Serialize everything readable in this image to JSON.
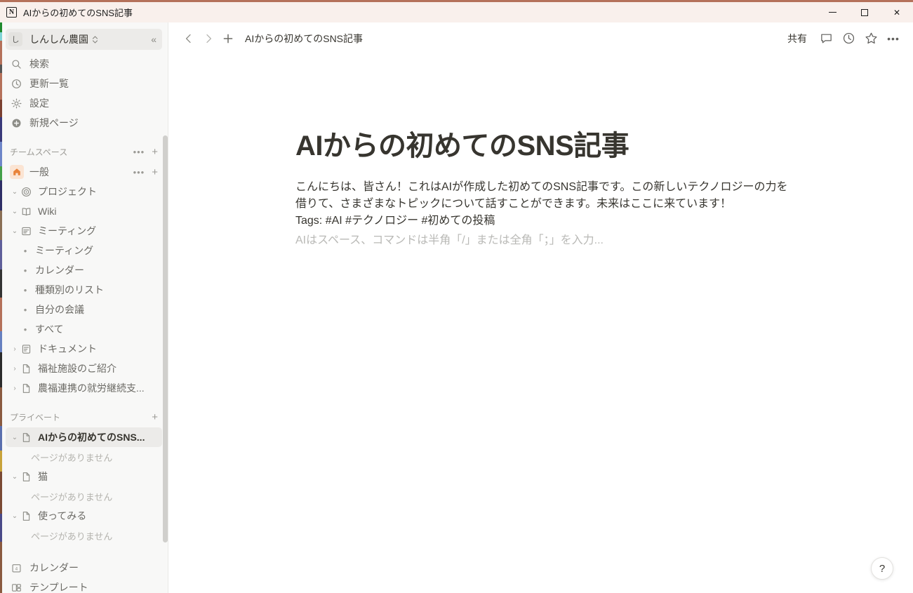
{
  "titlebar": {
    "logo_icon": "notion-logo-icon",
    "title": "AIからの初めてのSNS記事",
    "minimize_label": "",
    "maximize_label": "",
    "close_label": "✕"
  },
  "sidebar": {
    "workspace": {
      "avatar_text": "し",
      "name": "しんしん農園",
      "chevron_icon": "chevron-updown-icon",
      "collapse_icon": "collapse-sidebar-icon",
      "collapse_glyph": "«"
    },
    "nav": [
      {
        "label": "検索",
        "icon": "search-icon"
      },
      {
        "label": "更新一覧",
        "icon": "clock-icon"
      },
      {
        "label": "設定",
        "icon": "gear-icon"
      },
      {
        "label": "新規ページ",
        "icon": "plus-circle-icon"
      }
    ],
    "teamspace_section": {
      "title": "チームスペース",
      "dots": "•••",
      "plus": "+"
    },
    "teamspace_items": [
      {
        "label": "一般",
        "icon": "home-icon",
        "type": "home",
        "has_actions": true,
        "dots": "•••",
        "plus": "+"
      },
      {
        "label": "プロジェクト",
        "icon": "target-icon",
        "type": "page",
        "toggle": "⌄"
      },
      {
        "label": "Wiki",
        "icon": "book-icon",
        "type": "page",
        "toggle": "⌄"
      },
      {
        "label": "ミーティング",
        "icon": "list-icon",
        "type": "page",
        "toggle": "⌄"
      }
    ],
    "meeting_children": [
      {
        "label": "ミーティング",
        "bullet": "•"
      },
      {
        "label": "カレンダー",
        "bullet": "•"
      },
      {
        "label": "種類別のリスト",
        "bullet": "•"
      },
      {
        "label": "自分の会議",
        "bullet": "•"
      },
      {
        "label": "すべて",
        "bullet": "•"
      }
    ],
    "teamspace_items2": [
      {
        "label": "ドキュメント",
        "icon": "doc-list-icon",
        "toggle": "›"
      },
      {
        "label": "福祉施設のご紹介",
        "icon": "file-icon",
        "toggle": "›"
      },
      {
        "label": "農福連携の就労継続支...",
        "icon": "file-icon",
        "toggle": "›"
      }
    ],
    "private_section": {
      "title": "プライベート",
      "plus": "+"
    },
    "private_items": [
      {
        "label": "AIからの初めてのSNS...",
        "icon": "file-icon",
        "toggle": "⌄",
        "selected": true,
        "empty_label": "ページがありません"
      },
      {
        "label": "猫",
        "icon": "file-icon",
        "toggle": "⌄",
        "selected": false,
        "empty_label": "ページがありません"
      },
      {
        "label": "使ってみる",
        "icon": "file-icon",
        "toggle": "⌄",
        "selected": false,
        "empty_label": "ページがありません"
      }
    ],
    "bottom_items": [
      {
        "label": "カレンダー",
        "icon": "calendar-icon"
      },
      {
        "label": "テンプレート",
        "icon": "template-icon"
      }
    ]
  },
  "topbar": {
    "back_icon": "chevron-left-icon",
    "forward_icon": "chevron-right-icon",
    "new_icon": "plus-icon",
    "breadcrumb": "AIからの初めてのSNS記事",
    "share_label": "共有",
    "comment_icon": "comment-icon",
    "history_icon": "clock-history-icon",
    "favorite_icon": "star-icon",
    "more_icon": "more-horizontal-icon",
    "more_glyph": "•••"
  },
  "document": {
    "title": "AIからの初めてのSNS記事",
    "paragraph": "こんにちは、皆さん！これはAIが作成した初めてのSNS記事です。この新しいテクノロジーの力を借りて、さまざまなトピックについて話すことができます。未来はここに来ています！",
    "tags_line": "Tags: #AI #テクノロジー #初めての投稿",
    "placeholder": "AIはスペース、コマンドは半角「/」または全角「；」を入力..."
  },
  "help": {
    "label": "?",
    "icon": "help-icon"
  },
  "colors": {
    "titlebar_bg": "#f9f0ec",
    "top_border": "#b5715a",
    "sidebar_bg": "#f8f8f7",
    "text_primary": "#37352f",
    "text_muted": "#6b6a65",
    "accent_home": "#e8833a",
    "placeholder": "#b9b9b6"
  }
}
